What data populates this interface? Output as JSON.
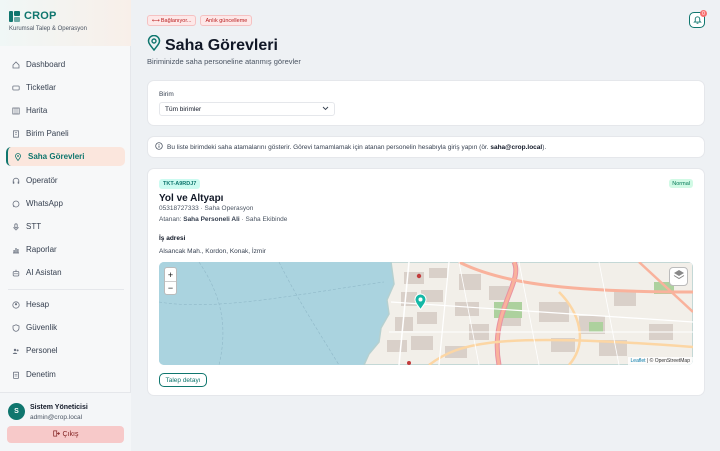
{
  "brand": {
    "name": "CROP",
    "subtitle": "Kurumsal Talep & Operasyon"
  },
  "sidebar": {
    "items": [
      {
        "label": "Dashboard",
        "icon": "home-icon"
      },
      {
        "label": "Ticketlar",
        "icon": "ticket-icon"
      },
      {
        "label": "Harita",
        "icon": "map-icon"
      },
      {
        "label": "Birim Paneli",
        "icon": "building-icon"
      },
      {
        "label": "Saha Görevleri",
        "icon": "map-pin-icon",
        "active": true
      },
      {
        "label": "Operatör",
        "icon": "headset-icon"
      },
      {
        "label": "WhatsApp",
        "icon": "whatsapp-icon"
      },
      {
        "label": "STT",
        "icon": "microphone-icon"
      },
      {
        "label": "Raporlar",
        "icon": "chart-icon"
      },
      {
        "label": "AI Asistan",
        "icon": "robot-icon"
      }
    ],
    "items2": [
      {
        "label": "Hesap",
        "icon": "user-circle-icon"
      },
      {
        "label": "Güvenlik",
        "icon": "shield-icon"
      },
      {
        "label": "Personel",
        "icon": "users-icon"
      },
      {
        "label": "Denetim",
        "icon": "clipboard-icon"
      }
    ]
  },
  "user": {
    "initial": "S",
    "name": "Sistem Yöneticisi",
    "email": "admin@crop.local",
    "logout": "Çıkış"
  },
  "status": {
    "connecting": "Bağlanıyor...",
    "live": "Anlık güncelleme"
  },
  "notifications": {
    "count": "0"
  },
  "page": {
    "title": "Saha Görevleri",
    "subtitle": "Biriminizde saha personeline atanmış görevler"
  },
  "filter": {
    "label": "Birim",
    "selected": "Tüm birimler"
  },
  "info": {
    "text": "Bu liste birimdeki saha atamalarını gösterir. Görevi tamamlamak için atanan personelin hesabıyla giriş yapın (ör.",
    "example": "saha@crop.local",
    "suffix": ")."
  },
  "task": {
    "id": "TKT-A9RDJ7",
    "priority": "Normal",
    "title": "Yol ve Altyapı",
    "phone_unit": "05318727333 · Saha Operasyon",
    "assigned_label": "Atanan:",
    "assigned_name": "Saha Personeli Ali",
    "assigned_team": " · Saha Ekibinde",
    "address_label": "İş adresi",
    "address": "Alsancak Mah., Kordon, Konak, İzmir",
    "detail_button": "Talep detayı"
  },
  "map": {
    "zoom_in": "+",
    "zoom_out": "−",
    "attribution_leaflet": "Leaflet",
    "attribution_osm": " | © OpenStreetMap"
  },
  "colors": {
    "accent": "#0f766e",
    "danger": "#b91c1c",
    "water": "#aad3df",
    "land": "#f2efe9"
  }
}
